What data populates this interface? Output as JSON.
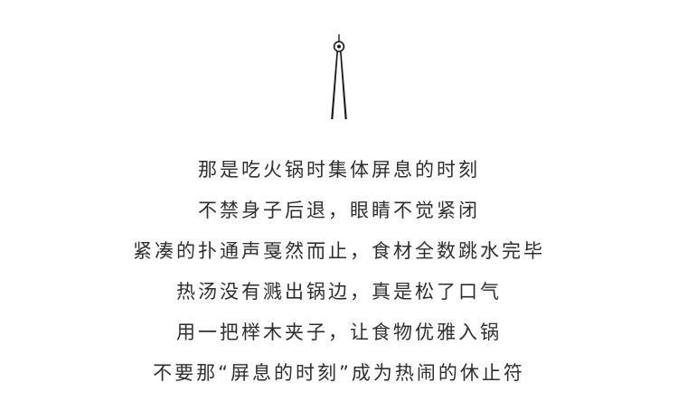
{
  "icon": {
    "name": "tongs-icon",
    "color": "#1a1a1a"
  },
  "poem": {
    "lines": [
      "那是吃火锅时集体屏息的时刻",
      "不禁身子后退，眼睛不觉紧闭",
      "紧凑的扑通声戛然而止，食材全数跳水完毕",
      "热汤没有溅出锅边，真是松了口气",
      "用一把榉木夹子，让食物优雅入锅",
      "不要那“屏息的时刻”成为热闹的休止符"
    ],
    "text_color": "#2e2e2e"
  }
}
